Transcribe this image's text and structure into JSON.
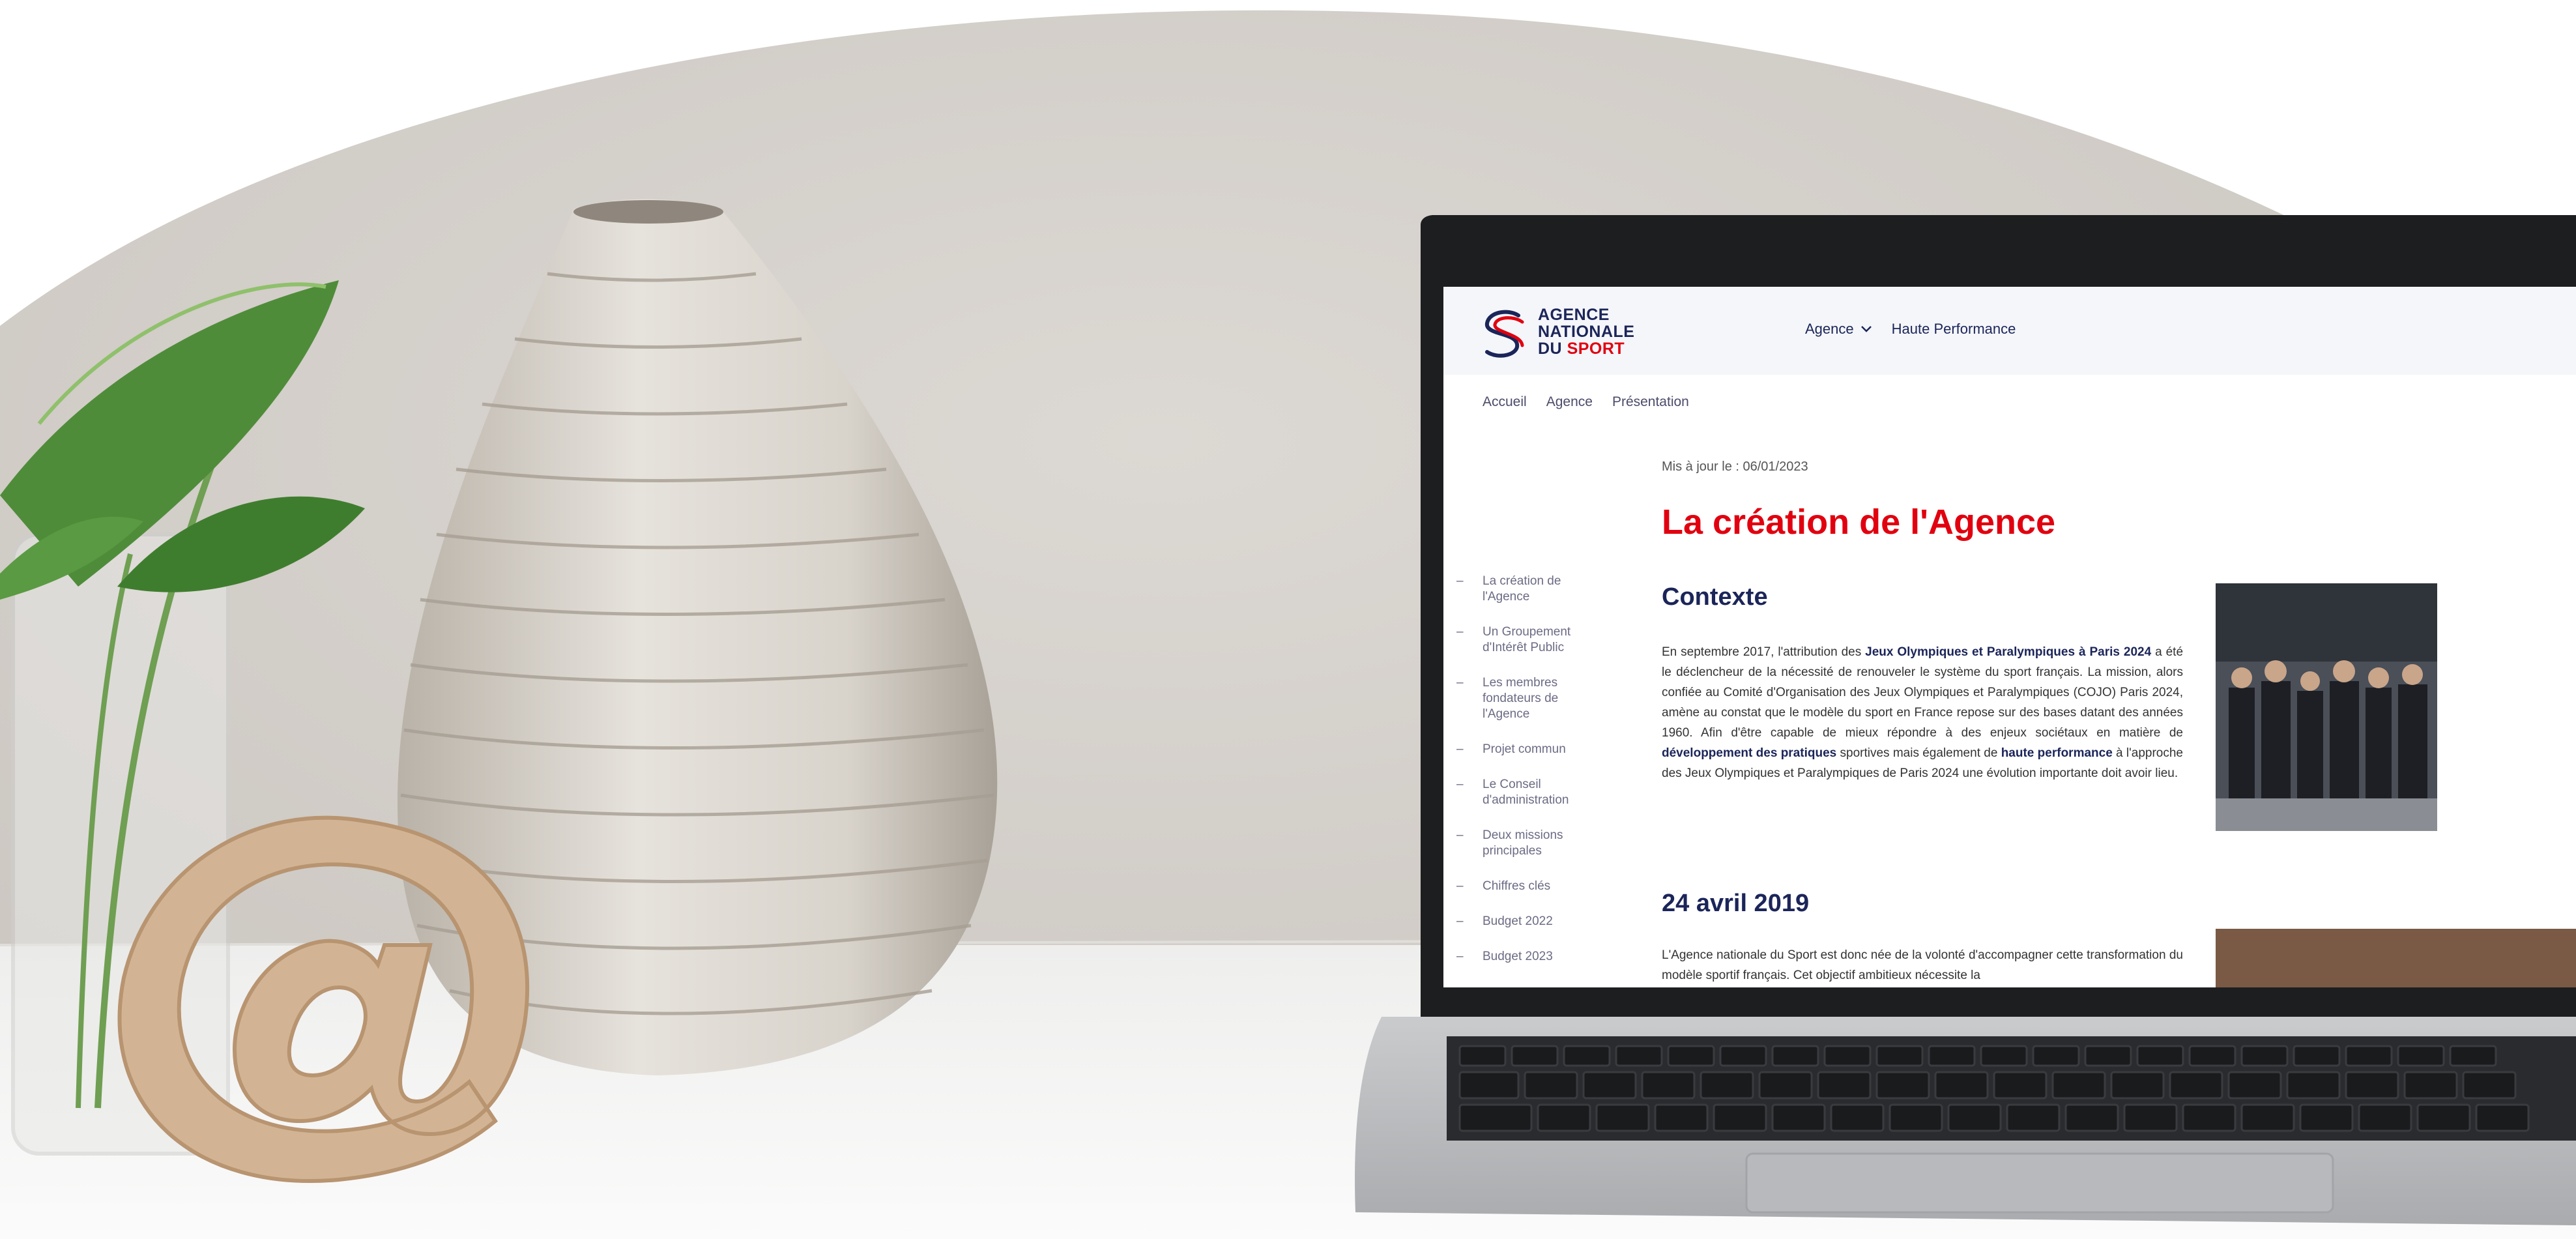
{
  "site": {
    "logo": {
      "line1": "AGENCE",
      "line2": "NATIONALE",
      "line3_prefix": "DU ",
      "line3_red": "SPORT"
    },
    "nav": [
      {
        "label": "Agence"
      },
      {
        "label": "Haute Performance"
      }
    ],
    "breadcrumb": [
      "Accueil",
      "Agence",
      "Présentation"
    ],
    "updated": "Mis à jour le : 06/01/2023",
    "title": "La création de l'Agence",
    "sidebar": [
      "La création de l'Agence",
      "Un Groupement d'Intérêt Public",
      "Les membres fondateurs de l'Agence",
      "Projet commun",
      "Le Conseil d'administration",
      "Deux missions principales",
      "Chiffres clés",
      "Budget 2022",
      "Budget 2023"
    ],
    "section1": {
      "heading": "Contexte",
      "p_a": "En septembre 2017, l'attribution des ",
      "p_b": "Jeux Olympiques et Paralympiques à Paris 2024",
      "p_c": " a été le déclencheur de la nécessité de renouveler le système du sport français. La mission, alors confiée au Comité d'Organisation des Jeux Olympiques et Paralympiques (COJO) Paris 2024, amène au constat que le modèle du sport en France repose sur des bases datant des années 1960. Afin d'être capable de mieux répondre à des enjeux sociétaux en matière de ",
      "p_d": "développement des pratiques",
      "p_e": " sportives mais également de ",
      "p_f": "haute performance",
      "p_g": " à l'approche des Jeux Olympiques et Paralympiques de Paris 2024 une évolution importante doit avoir lieu."
    },
    "section2": {
      "heading": "24 avril 2019",
      "p": "L'Agence nationale du Sport est donc née de la volonté d'accompagner cette transformation du modèle sportif français. Cet objectif ambitieux nécessite la"
    }
  },
  "colors": {
    "brand_red": "#e1000f",
    "brand_navy": "#1b2559",
    "wall": "#d7d3ce",
    "desk": "#f4f4f3"
  },
  "icons": {
    "at_sign": "at-sign-decor",
    "chevron": "chevron-down-icon"
  }
}
